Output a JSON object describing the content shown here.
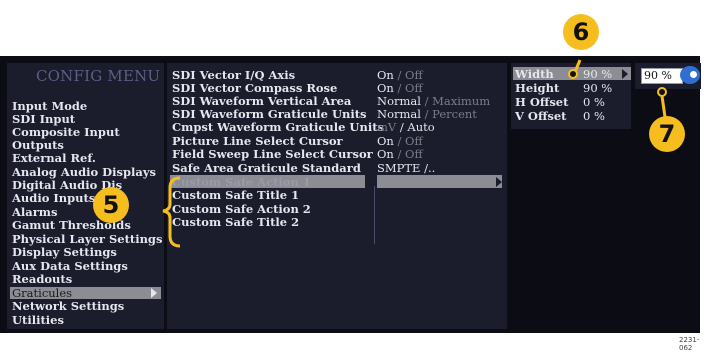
{
  "config_menu": {
    "title": "CONFIG MENU",
    "items": [
      {
        "label": "Input Mode"
      },
      {
        "label": "SDI Input"
      },
      {
        "label": "Composite Input"
      },
      {
        "label": "Outputs"
      },
      {
        "label": "External Ref."
      },
      {
        "label": "Analog Audio Displays"
      },
      {
        "label": "Digital Audio Dis"
      },
      {
        "label": "Audio Inputs/O"
      },
      {
        "label": "Alarms"
      },
      {
        "label": "Gamut Thresholds"
      },
      {
        "label": "Physical Layer Settings"
      },
      {
        "label": "Display Settings"
      },
      {
        "label": "Aux Data Settings"
      },
      {
        "label": "Readouts"
      },
      {
        "label": "Graticules",
        "selected": true
      },
      {
        "label": "Network Settings"
      },
      {
        "label": "Utilities"
      }
    ]
  },
  "graticule_settings": [
    {
      "label": "SDI Vector I/Q Axis",
      "value": "On",
      "alt": " / Off"
    },
    {
      "label": "SDI Vector Compass Rose",
      "value": "On",
      "alt": " / Off"
    },
    {
      "label": "SDI Waveform Vertical Area",
      "value": "Normal",
      "alt": " / Maximum"
    },
    {
      "label": "SDI Waveform Graticule Units",
      "value": "Normal",
      "alt": " / Percent"
    },
    {
      "label": "Cmpst Waveform Graticule Units",
      "value": "mV",
      "alt": " / Auto"
    },
    {
      "label": "Picture Line Select Cursor",
      "value": "On",
      "alt": " / Off"
    },
    {
      "label": "Field Sweep Line Select Cursor",
      "value": "On",
      "alt": " / Off"
    },
    {
      "label": "Safe Area Graticule Standard",
      "value": "SMPTE /..",
      "alt": ""
    },
    {
      "label": "Custom Safe Action 1",
      "selected": true
    },
    {
      "label": "Custom Safe Title  1"
    },
    {
      "label": "Custom Safe Action 2"
    },
    {
      "label": "Custom Safe Title  2"
    }
  ],
  "sub_settings": [
    {
      "label": "Width",
      "value": "90 %",
      "selected": true
    },
    {
      "label": "Height",
      "value": "90 %"
    },
    {
      "label": "H Offset",
      "value": "0 %"
    },
    {
      "label": "V Offset",
      "value": "0 %"
    }
  ],
  "edit_field": {
    "value": "90 %"
  },
  "knob_icon": "general-purpose-knob-icon",
  "callouts": {
    "c5": "5",
    "c6": "6",
    "c7": "7"
  },
  "footnote": "2231-062",
  "colors": {
    "callout": "#f5be1e",
    "panel": "#1b1c2c",
    "highlight": "#8c8c95",
    "knob": "#2f6fd2"
  }
}
